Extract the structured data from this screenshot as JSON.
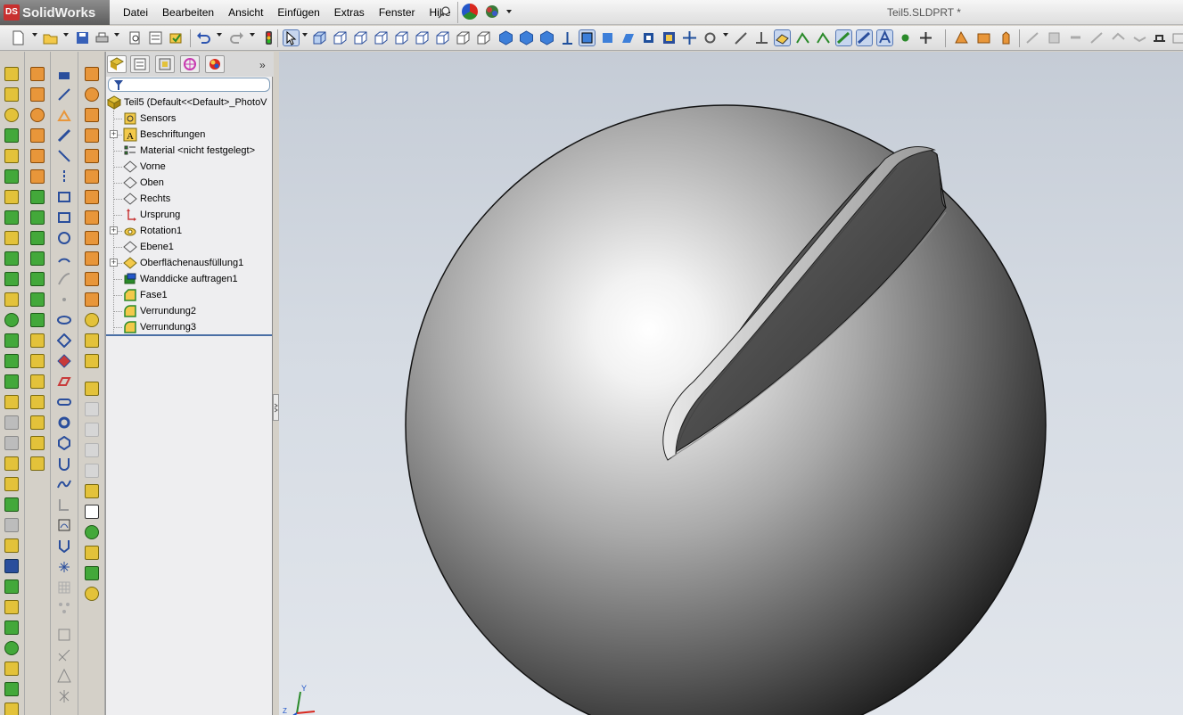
{
  "app": {
    "name": "SolidWorks",
    "badge": "DS"
  },
  "menu": [
    "Datei",
    "Bearbeiten",
    "Ansicht",
    "Einfügen",
    "Extras",
    "Fenster",
    "Hilfe"
  ],
  "document_title": "Teil5.SLDPRT *",
  "feature_tree": {
    "root": "Teil5  (Default<<Default>_PhotoV",
    "items": [
      {
        "label": "Sensors",
        "expandable": false,
        "icon": "sensor-icon"
      },
      {
        "label": "Beschriftungen",
        "expandable": true,
        "icon": "annotation-icon"
      },
      {
        "label": "Material <nicht festgelegt>",
        "expandable": false,
        "icon": "material-icon"
      },
      {
        "label": "Vorne",
        "expandable": false,
        "icon": "plane-icon"
      },
      {
        "label": "Oben",
        "expandable": false,
        "icon": "plane-icon"
      },
      {
        "label": "Rechts",
        "expandable": false,
        "icon": "plane-icon"
      },
      {
        "label": "Ursprung",
        "expandable": false,
        "icon": "origin-icon"
      },
      {
        "label": "Rotation1",
        "expandable": true,
        "icon": "revolve-icon"
      },
      {
        "label": "Ebene1",
        "expandable": false,
        "icon": "plane-icon"
      },
      {
        "label": "Oberflächenausfüllung1",
        "expandable": true,
        "icon": "surface-fill-icon"
      },
      {
        "label": "Wanddicke auftragen1",
        "expandable": false,
        "icon": "thicken-icon"
      },
      {
        "label": "Fase1",
        "expandable": false,
        "icon": "chamfer-icon"
      },
      {
        "label": "Verrundung2",
        "expandable": false,
        "icon": "fillet-icon"
      },
      {
        "label": "Verrundung3",
        "expandable": false,
        "icon": "fillet-icon"
      }
    ]
  },
  "triad": {
    "y": "Y",
    "z": "Z"
  },
  "colors": {
    "accent": "#4a6fa5",
    "tree_bg": "#eeeef0",
    "viewport_top": "#c5ccd6",
    "viewport_bottom": "#e2e6ec",
    "logo_red": "#c8302f"
  }
}
